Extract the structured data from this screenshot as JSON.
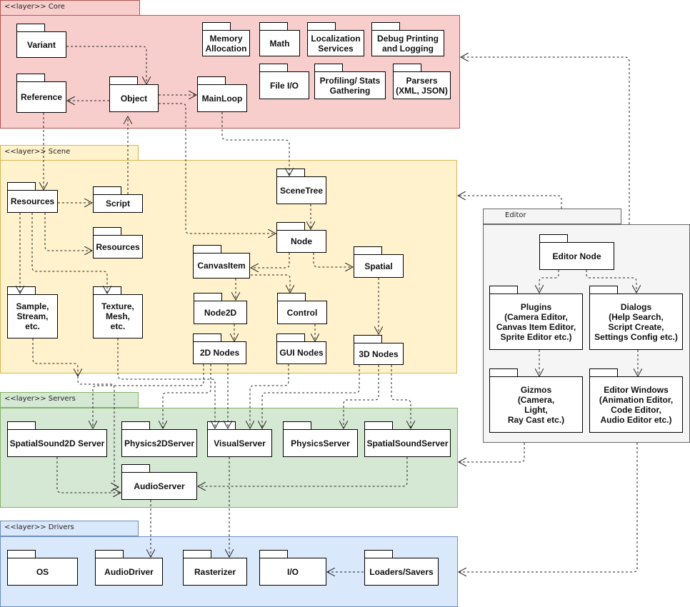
{
  "layers": {
    "core": "<<layer>> Core",
    "scene": "<<layer>> Scene",
    "servers": "<<layer>> Servers",
    "drivers": "<<layer>> Drivers",
    "editor": "Editor"
  },
  "packages": {
    "variant": "Variant",
    "reference": "Reference",
    "object": "Object",
    "mainloop": "MainLoop",
    "memory": "Memory\nAllocation",
    "math": "Math",
    "localization": "Localization\nServices",
    "debug": "Debug Printing\nand Logging",
    "fileio": "File I/O",
    "profiling": "Profiling/ Stats\nGathering",
    "parsers": "Parsers\n(XML, JSON)",
    "scene_resources": "Resources",
    "script": "Script",
    "resources2": "Resources",
    "sample": "Sample,\nStream,\netc.",
    "texture": "Texture,\nMesh,\netc.",
    "scenetree": "SceneTree",
    "node": "Node",
    "canvasitem": "CanvasItem",
    "spatial": "Spatial",
    "node2d": "Node2D",
    "control": "Control",
    "nodes2d": "2D Nodes",
    "guinodes": "GUI Nodes",
    "nodes3d": "3D Nodes",
    "ss2dserver": "SpatialSound2D Server",
    "physics2d": "Physics2DServer",
    "visualserver": "VisualServer",
    "physicsserver": "PhysicsServer",
    "ssserver": "SpatialSoundServer",
    "audioserver": "AudioServer",
    "os": "OS",
    "audiodriver": "AudioDriver",
    "rasterizer": "Rasterizer",
    "io": "I/O",
    "loaders": "Loaders/Savers",
    "editornode": "Editor Node",
    "plugins": "Plugins\n(Camera Editor,\nCanvas Item Editor,\nSprite Editor etc.)",
    "dialogs": "Dialogs\n(Help Search,\nScript Create,\nSettings Config etc.)",
    "gizmos": "Gizmos\n(Camera,\nLight,\nRay Cast etc.)",
    "editorwindows": "Editor Windows\n(Animation Editor,\nCode Editor,\nAudio Editor etc.)"
  }
}
